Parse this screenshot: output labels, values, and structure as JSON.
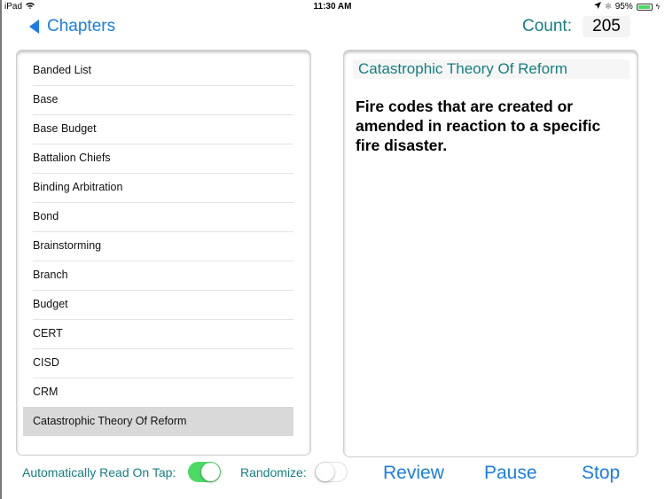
{
  "status_bar": {
    "device": "iPad",
    "time": "11:30 AM",
    "battery": "95%",
    "battery_level": 0.95
  },
  "nav": {
    "back_label": "Chapters",
    "count_label": "Count:",
    "count_value": "205"
  },
  "list": {
    "items": [
      {
        "label": "Banded List"
      },
      {
        "label": "Base"
      },
      {
        "label": "Base Budget"
      },
      {
        "label": "Battalion Chiefs"
      },
      {
        "label": "Binding Arbitration"
      },
      {
        "label": "Bond"
      },
      {
        "label": "Brainstorming"
      },
      {
        "label": "Branch"
      },
      {
        "label": "Budget"
      },
      {
        "label": "CERT"
      },
      {
        "label": "CISD"
      },
      {
        "label": "CRM"
      },
      {
        "label": "Catastrophic Theory Of Reform"
      }
    ],
    "selected_index": 12
  },
  "detail": {
    "title": "Catastrophic Theory Of Reform",
    "definition": "Fire codes that are created or amended in reaction to a specific fire disaster."
  },
  "controls": {
    "auto_read_label": "Automatically Read On Tap:",
    "auto_read_on": true,
    "randomize_label": "Randomize:",
    "randomize_on": false,
    "review_label": "Review",
    "pause_label": "Pause",
    "stop_label": "Stop"
  },
  "colors": {
    "accent_blue": "#1a7ee6",
    "teal": "#157f7f",
    "toggle_green": "#4cd964",
    "selected_row": "#d9d9d9"
  }
}
